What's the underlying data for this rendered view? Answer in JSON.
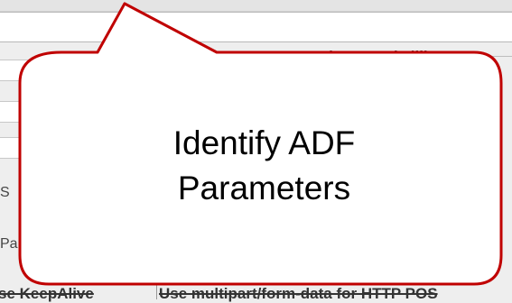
{
  "background": {
    "timeouts_legend": "Timeouts (millisecc",
    "side_letters": [
      "Pa",
      "S"
    ],
    "checkbox_left": "se KeepAlive",
    "checkbox_right": "Use multipart/form-data for HTTP POS"
  },
  "callout": {
    "line1": "Identify ADF",
    "line2": "Parameters",
    "border_color": "#c00000",
    "fill_color": "#ffffff"
  }
}
